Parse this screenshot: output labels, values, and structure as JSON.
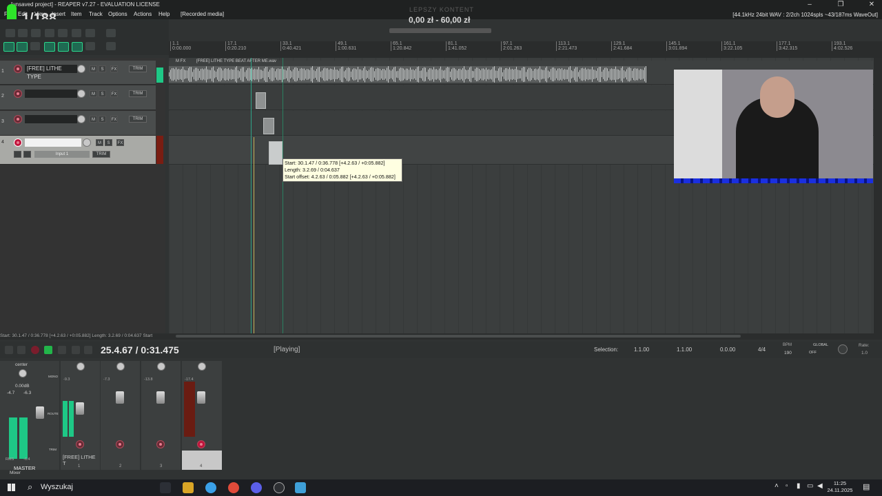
{
  "window": {
    "title": "[unsaved project] - REAPER v7.27 - EVALUATION LICENSE"
  },
  "menu": [
    "File",
    "Edit",
    "View",
    "Insert",
    "Item",
    "Track",
    "Options",
    "Actions",
    "Help",
    "[Recorded media]"
  ],
  "menu_visible": {
    "file": "Fi",
    "edit": "Edit",
    "view": "View",
    "insert": "Insert",
    "item": "Item",
    "track": "Track",
    "options": "Options",
    "actions": "Actions",
    "help": "Help",
    "recorded": "[Recorded media]"
  },
  "audio_status": "[44.1kHz 24bit WAV : 2/2ch 1024spls ~43/187ms WaveOut]",
  "overlay": {
    "top_text": "LEPSZY KONTENT",
    "price": "0,00 zł - 60,00 zł",
    "big": "1/188"
  },
  "ruler": [
    {
      "bar": "1.1",
      "time": "0:00.000"
    },
    {
      "bar": "17.1",
      "time": "0:20.210"
    },
    {
      "bar": "33.1",
      "time": "0:40.421"
    },
    {
      "bar": "49.1",
      "time": "1:00.631"
    },
    {
      "bar": "65.1",
      "time": "1:20.842"
    },
    {
      "bar": "81.1",
      "time": "1:41.052"
    },
    {
      "bar": "97.1",
      "time": "2:01.263"
    },
    {
      "bar": "113.1",
      "time": "2:21.473"
    },
    {
      "bar": "129.1",
      "time": "2:41.684"
    },
    {
      "bar": "145.1",
      "time": "3:01.894"
    },
    {
      "bar": "161.1",
      "time": "3:22.105"
    },
    {
      "bar": "177.1",
      "time": "3:42.315"
    },
    {
      "bar": "193.1",
      "time": "4:02.526"
    }
  ],
  "tracks": [
    {
      "num": "1",
      "name": "[FREE] LITHE TYPE"
    },
    {
      "num": "2",
      "name": ""
    },
    {
      "num": "3",
      "name": ""
    },
    {
      "num": "4",
      "name": "",
      "input": "Input 1"
    }
  ],
  "track_buttons": {
    "mute": "M",
    "solo": "S",
    "fx": "FX",
    "trim": "TRIM"
  },
  "item": {
    "label": "[FREE] LITHE TYPE BEAT AFTER ME.wav",
    "flags": "M FX"
  },
  "tooltip": [
    "Start: 30.1.47 / 0:36.778 [+4.2.63 / +0:05.882]",
    "Length: 3.2.69 / 0:04.637",
    "Start offset: 4.2.63 / 0:05.882 [+4.2.63 / +0:05.882]"
  ],
  "statusline": "Start: 30.1.47 / 0:36.778 [+4.2.63 / +0:05.882] Length: 3.2.69 / 0:04.637 Start",
  "transport": {
    "time": "25.4.67 / 0:31.475",
    "state": "[Playing]",
    "selection_label": "Selection:",
    "sel_start": "1.1.00",
    "sel_end": "1.1.00",
    "sel_len": "0.0.00",
    "timesig": "4/4",
    "bpm_label": "BPM",
    "bpm": "190",
    "global_label": "GLOBAL",
    "global_state": "OFF",
    "rate_label": "Rate:",
    "rate": "1.0"
  },
  "mixer": {
    "master": {
      "pan": "center",
      "vol": "0.00dB",
      "peakL": "-4.7",
      "peakR": "-6.3",
      "rms": "RMS",
      "rmsval": "-6.4",
      "label": "MASTER",
      "mono": "MONO",
      "route": "ROUTE",
      "trim": "TRIM"
    },
    "strips": [
      {
        "num": "1",
        "peak": "-9.3",
        "name": "[FREE] LITHE T"
      },
      {
        "num": "2",
        "peak": "-7.3",
        "name": ""
      },
      {
        "num": "3",
        "peak": "-13.8",
        "name": ""
      },
      {
        "num": "4",
        "peak": "-17.4",
        "name": ""
      }
    ],
    "mixer_tab": "Mixer"
  },
  "taskbar": {
    "search": "Wyszukaj",
    "time": "11:25",
    "date": "24.11.2025"
  },
  "colors": {
    "accent_green": "#2ee62a",
    "meter": "#1ec886",
    "record": "#e87c8f",
    "tooltip": "#ffffe1"
  }
}
